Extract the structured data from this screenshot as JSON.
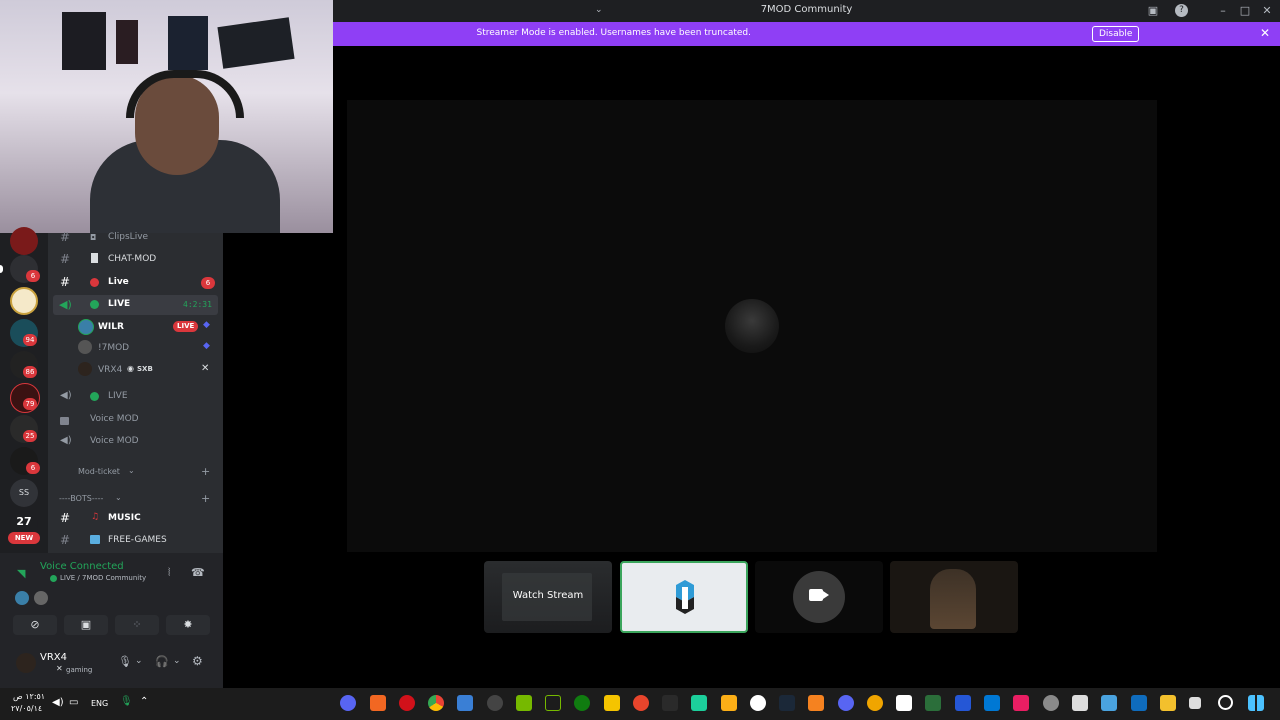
{
  "window": {
    "title": "7MOD Community"
  },
  "streamer_bar": {
    "message": "Streamer Mode is enabled. Usernames have been truncated.",
    "disable_label": "Disable"
  },
  "tiles": {
    "watch_label": "Watch Stream"
  },
  "channels": [
    {
      "name": "ClipsLive",
      "icon": "camera-icon"
    },
    {
      "name": "CHAT-MOD",
      "icon": "document-icon"
    },
    {
      "name": "Live",
      "badge": "6",
      "status_color": "#da373c"
    },
    {
      "name": "LIVE",
      "timer": "4:2:31",
      "status_color": "#23a55a"
    },
    {
      "name": "LIVE",
      "status_color": "#23a55a"
    },
    {
      "name": "Voice MOD",
      "icon": "lock-icon"
    },
    {
      "name": "Voice MOD"
    }
  ],
  "voice_users": [
    {
      "name": "WILR",
      "live_badge": "LIVE"
    },
    {
      "name": "!7MOD"
    },
    {
      "name": "VRX4",
      "tag": "SXB"
    }
  ],
  "categories": [
    {
      "name": "Mod-ticket"
    },
    {
      "name": "----BOTS----"
    }
  ],
  "bot_channels": [
    {
      "name": "MUSIC"
    },
    {
      "name": "FREE-GAMES"
    }
  ],
  "servers": {
    "badges": [
      "6",
      "94",
      "86",
      "79",
      "25",
      "6"
    ],
    "text_server": "SS",
    "date_day": "27",
    "new_badge": "NEW"
  },
  "voice_panel": {
    "status": "Voice Connected",
    "location": "LIVE / 7MOD Community"
  },
  "user": {
    "name": "VRX4",
    "status": "gaming"
  },
  "taskbar": {
    "time": "١٢:٥١ ص",
    "date": "٢٧/٠٥/١٤",
    "lang": "ENG"
  },
  "colors": {
    "accent": "#8f3ff5",
    "online": "#23a55a",
    "danger": "#da373c"
  }
}
